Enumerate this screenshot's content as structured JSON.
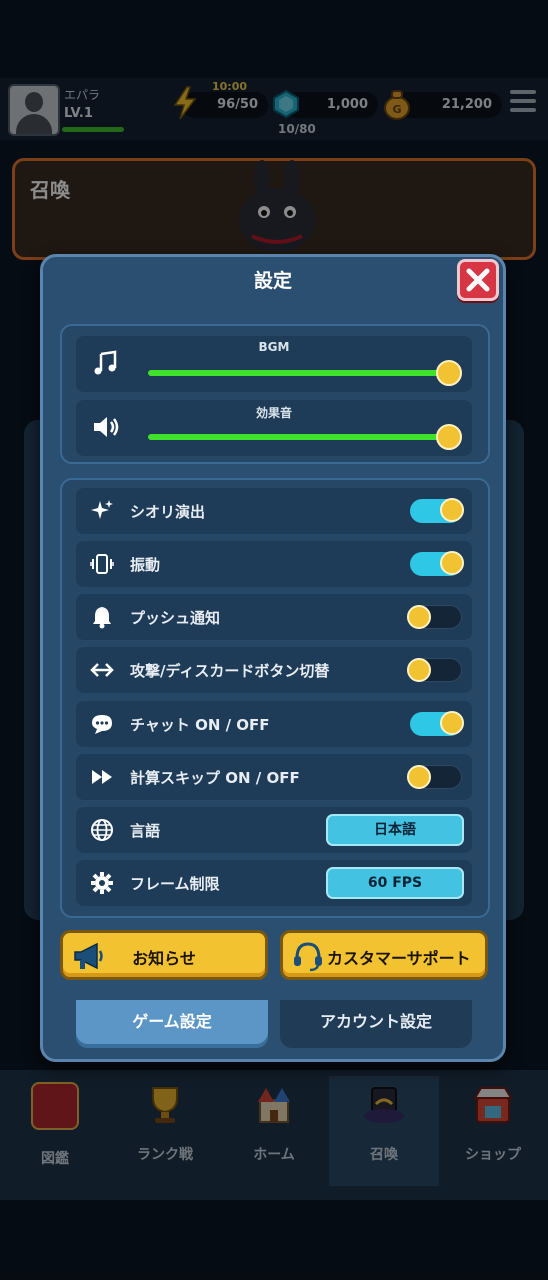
{
  "header": {
    "player_name": "エパラ",
    "level": "LV.1",
    "stamina_timer": "10:00",
    "stamina": "96/50",
    "gems": "1,000",
    "gold": "21,200",
    "sub_count": "10/80"
  },
  "background": {
    "summon_title": "召喚"
  },
  "dialog": {
    "title": "設定",
    "sliders": [
      {
        "label": "BGM",
        "value_pct": 100
      },
      {
        "label": "効果音",
        "value_pct": 100
      }
    ],
    "toggles": [
      {
        "label": "シオリ演出",
        "on": true
      },
      {
        "label": "振動",
        "on": true
      },
      {
        "label": "プッシュ通知",
        "on": false
      },
      {
        "label": "攻撃/ディスカードボタン切替",
        "on": false
      },
      {
        "label": "チャット ON / OFF",
        "on": true
      },
      {
        "label": "計算スキップ ON / OFF",
        "on": false
      }
    ],
    "language_label": "言語",
    "language_value": "日本語",
    "frame_label": "フレーム制限",
    "frame_value": "60 FPS",
    "notice_button": "お知らせ",
    "support_button": "カスタマーサポート",
    "tab_game": "ゲーム設定",
    "tab_account": "アカウント設定"
  },
  "bottom_nav": [
    {
      "label": "図鑑",
      "icon": "book-icon"
    },
    {
      "label": "ランク戦",
      "icon": "trophy-icon"
    },
    {
      "label": "ホーム",
      "icon": "castle-icon"
    },
    {
      "label": "召喚",
      "icon": "summon-hat-icon"
    },
    {
      "label": "ショップ",
      "icon": "shop-icon"
    }
  ],
  "colors": {
    "toggle_on": "#2ec8e6",
    "slider_fill": "#3fe12b",
    "accent_yellow": "#f2c230",
    "close_red": "#d63544"
  }
}
